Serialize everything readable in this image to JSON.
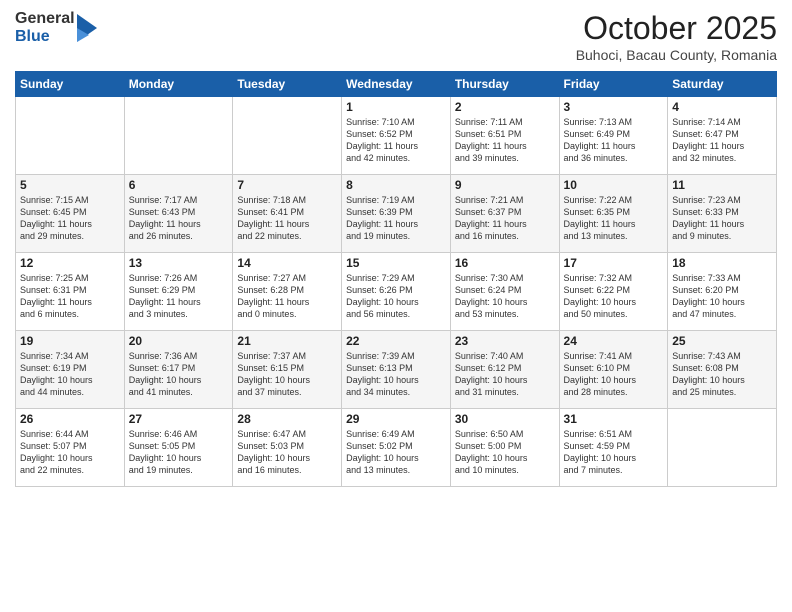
{
  "header": {
    "logo_general": "General",
    "logo_blue": "Blue",
    "month_title": "October 2025",
    "subtitle": "Buhoci, Bacau County, Romania"
  },
  "days_of_week": [
    "Sunday",
    "Monday",
    "Tuesday",
    "Wednesday",
    "Thursday",
    "Friday",
    "Saturday"
  ],
  "weeks": [
    [
      {
        "day": "",
        "info": ""
      },
      {
        "day": "",
        "info": ""
      },
      {
        "day": "",
        "info": ""
      },
      {
        "day": "1",
        "info": "Sunrise: 7:10 AM\nSunset: 6:52 PM\nDaylight: 11 hours\nand 42 minutes."
      },
      {
        "day": "2",
        "info": "Sunrise: 7:11 AM\nSunset: 6:51 PM\nDaylight: 11 hours\nand 39 minutes."
      },
      {
        "day": "3",
        "info": "Sunrise: 7:13 AM\nSunset: 6:49 PM\nDaylight: 11 hours\nand 36 minutes."
      },
      {
        "day": "4",
        "info": "Sunrise: 7:14 AM\nSunset: 6:47 PM\nDaylight: 11 hours\nand 32 minutes."
      }
    ],
    [
      {
        "day": "5",
        "info": "Sunrise: 7:15 AM\nSunset: 6:45 PM\nDaylight: 11 hours\nand 29 minutes."
      },
      {
        "day": "6",
        "info": "Sunrise: 7:17 AM\nSunset: 6:43 PM\nDaylight: 11 hours\nand 26 minutes."
      },
      {
        "day": "7",
        "info": "Sunrise: 7:18 AM\nSunset: 6:41 PM\nDaylight: 11 hours\nand 22 minutes."
      },
      {
        "day": "8",
        "info": "Sunrise: 7:19 AM\nSunset: 6:39 PM\nDaylight: 11 hours\nand 19 minutes."
      },
      {
        "day": "9",
        "info": "Sunrise: 7:21 AM\nSunset: 6:37 PM\nDaylight: 11 hours\nand 16 minutes."
      },
      {
        "day": "10",
        "info": "Sunrise: 7:22 AM\nSunset: 6:35 PM\nDaylight: 11 hours\nand 13 minutes."
      },
      {
        "day": "11",
        "info": "Sunrise: 7:23 AM\nSunset: 6:33 PM\nDaylight: 11 hours\nand 9 minutes."
      }
    ],
    [
      {
        "day": "12",
        "info": "Sunrise: 7:25 AM\nSunset: 6:31 PM\nDaylight: 11 hours\nand 6 minutes."
      },
      {
        "day": "13",
        "info": "Sunrise: 7:26 AM\nSunset: 6:29 PM\nDaylight: 11 hours\nand 3 minutes."
      },
      {
        "day": "14",
        "info": "Sunrise: 7:27 AM\nSunset: 6:28 PM\nDaylight: 11 hours\nand 0 minutes."
      },
      {
        "day": "15",
        "info": "Sunrise: 7:29 AM\nSunset: 6:26 PM\nDaylight: 10 hours\nand 56 minutes."
      },
      {
        "day": "16",
        "info": "Sunrise: 7:30 AM\nSunset: 6:24 PM\nDaylight: 10 hours\nand 53 minutes."
      },
      {
        "day": "17",
        "info": "Sunrise: 7:32 AM\nSunset: 6:22 PM\nDaylight: 10 hours\nand 50 minutes."
      },
      {
        "day": "18",
        "info": "Sunrise: 7:33 AM\nSunset: 6:20 PM\nDaylight: 10 hours\nand 47 minutes."
      }
    ],
    [
      {
        "day": "19",
        "info": "Sunrise: 7:34 AM\nSunset: 6:19 PM\nDaylight: 10 hours\nand 44 minutes."
      },
      {
        "day": "20",
        "info": "Sunrise: 7:36 AM\nSunset: 6:17 PM\nDaylight: 10 hours\nand 41 minutes."
      },
      {
        "day": "21",
        "info": "Sunrise: 7:37 AM\nSunset: 6:15 PM\nDaylight: 10 hours\nand 37 minutes."
      },
      {
        "day": "22",
        "info": "Sunrise: 7:39 AM\nSunset: 6:13 PM\nDaylight: 10 hours\nand 34 minutes."
      },
      {
        "day": "23",
        "info": "Sunrise: 7:40 AM\nSunset: 6:12 PM\nDaylight: 10 hours\nand 31 minutes."
      },
      {
        "day": "24",
        "info": "Sunrise: 7:41 AM\nSunset: 6:10 PM\nDaylight: 10 hours\nand 28 minutes."
      },
      {
        "day": "25",
        "info": "Sunrise: 7:43 AM\nSunset: 6:08 PM\nDaylight: 10 hours\nand 25 minutes."
      }
    ],
    [
      {
        "day": "26",
        "info": "Sunrise: 6:44 AM\nSunset: 5:07 PM\nDaylight: 10 hours\nand 22 minutes."
      },
      {
        "day": "27",
        "info": "Sunrise: 6:46 AM\nSunset: 5:05 PM\nDaylight: 10 hours\nand 19 minutes."
      },
      {
        "day": "28",
        "info": "Sunrise: 6:47 AM\nSunset: 5:03 PM\nDaylight: 10 hours\nand 16 minutes."
      },
      {
        "day": "29",
        "info": "Sunrise: 6:49 AM\nSunset: 5:02 PM\nDaylight: 10 hours\nand 13 minutes."
      },
      {
        "day": "30",
        "info": "Sunrise: 6:50 AM\nSunset: 5:00 PM\nDaylight: 10 hours\nand 10 minutes."
      },
      {
        "day": "31",
        "info": "Sunrise: 6:51 AM\nSunset: 4:59 PM\nDaylight: 10 hours\nand 7 minutes."
      },
      {
        "day": "",
        "info": ""
      }
    ]
  ]
}
